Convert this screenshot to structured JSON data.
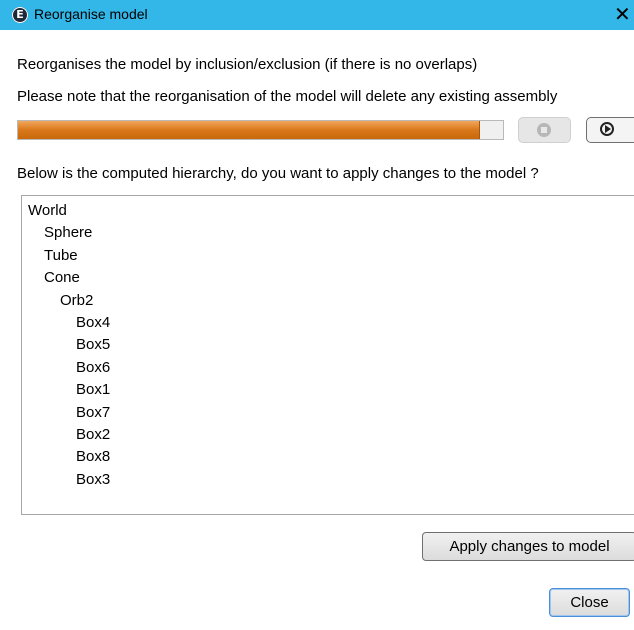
{
  "window": {
    "title": "Reorganise model",
    "close_glyph": "✕",
    "app_icon_letter": "E",
    "titlebar_color": "#33b6e8"
  },
  "description": "Reorganises the model by inclusion/exclusion (if there is no overlaps)",
  "note": "Please note that the reorganisation of the model will delete any existing assembly",
  "progress": {
    "fraction": 0.95,
    "fill_color": "#d9781a"
  },
  "buttons": {
    "stop_icon": "stop-icon",
    "play_icon": "play-icon",
    "apply_label": "Apply changes to model",
    "close_label_mnemonic": "C",
    "close_label_rest": "lose"
  },
  "question": "Below is the computed hierarchy, do you want to apply changes to the model ?",
  "hierarchy": [
    {
      "label": "World",
      "depth": 0
    },
    {
      "label": "Sphere",
      "depth": 1
    },
    {
      "label": "Tube",
      "depth": 1
    },
    {
      "label": "Cone",
      "depth": 1
    },
    {
      "label": "Orb2",
      "depth": 2
    },
    {
      "label": "Box4",
      "depth": 3
    },
    {
      "label": "Box5",
      "depth": 3
    },
    {
      "label": "Box6",
      "depth": 3
    },
    {
      "label": "Box1",
      "depth": 3
    },
    {
      "label": "Box7",
      "depth": 3
    },
    {
      "label": "Box2",
      "depth": 3
    },
    {
      "label": "Box8",
      "depth": 3
    },
    {
      "label": "Box3",
      "depth": 3
    }
  ]
}
